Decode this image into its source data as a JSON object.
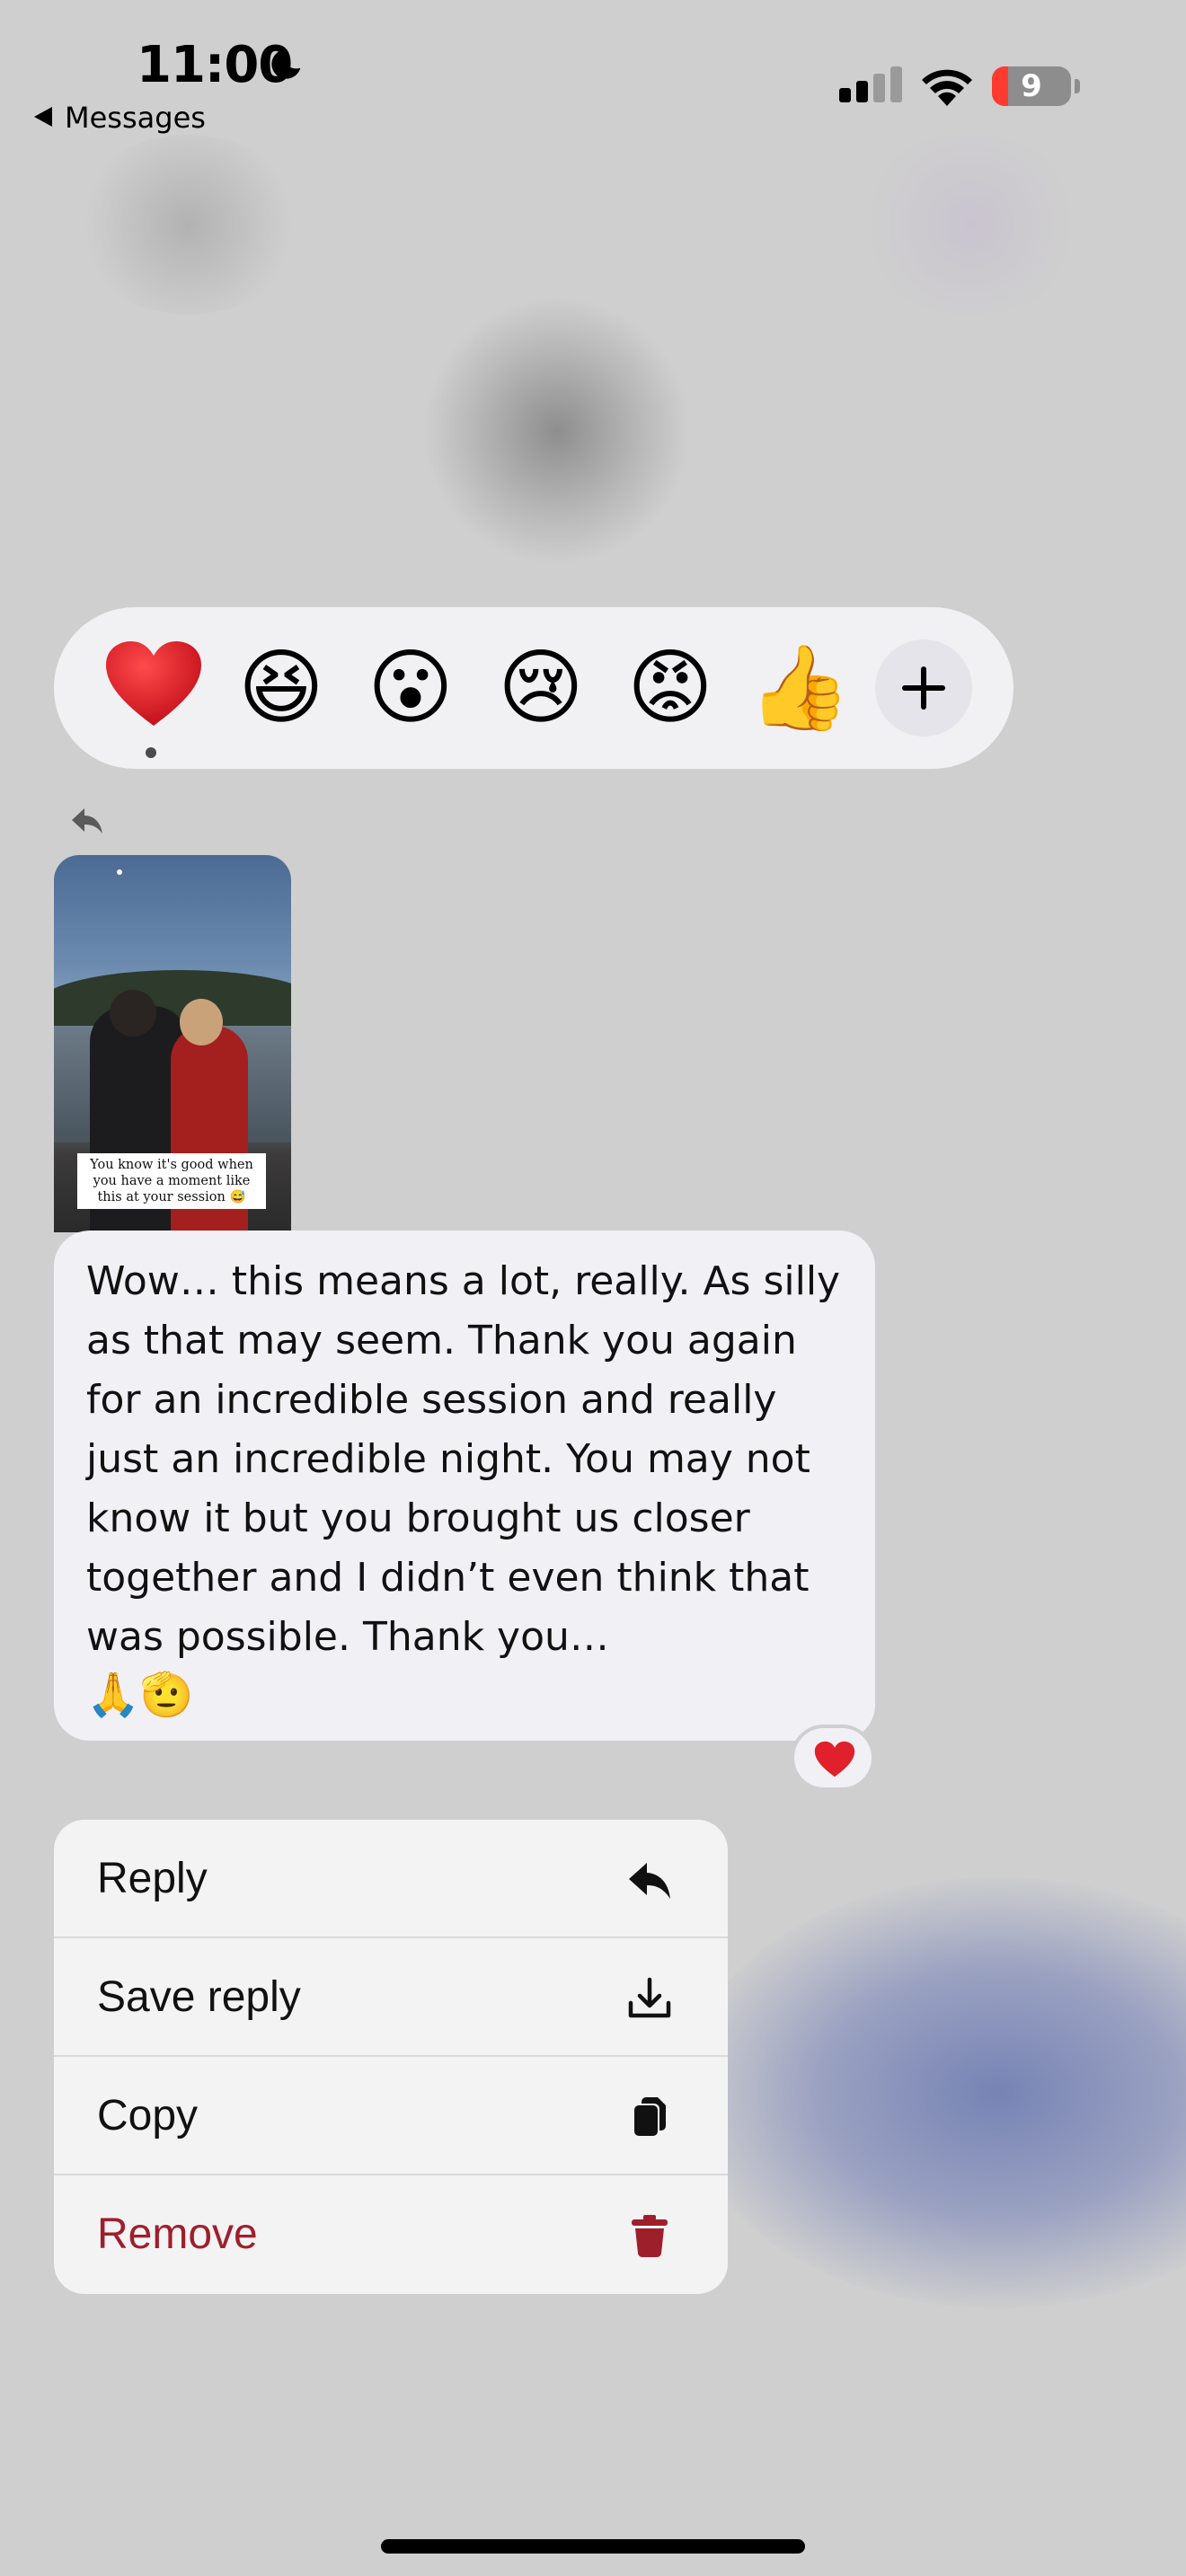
{
  "status_bar": {
    "time": "11:00",
    "back_app": "Messages",
    "battery_level": "9",
    "signal_bars": 2
  },
  "reactions": {
    "items": [
      {
        "name": "red-heart",
        "emoji": "❤️",
        "selected": true
      },
      {
        "name": "laughing",
        "emoji": "😆"
      },
      {
        "name": "surprised",
        "emoji": "😮"
      },
      {
        "name": "crying",
        "emoji": "😢"
      },
      {
        "name": "angry",
        "emoji": "😡"
      },
      {
        "name": "thumbs-up",
        "emoji": "👍"
      }
    ],
    "more_icon": "plus-icon"
  },
  "story": {
    "caption": "You know it's good when you have a moment like this at your session 😅"
  },
  "message": {
    "text": "Wow… this means a lot, really. As silly as that may seem. Thank you again for an incredible session and really just an incredible night. You may not know it but you brought us closer together and I didn’t even think that was possible. Thank you…",
    "emojis": "🙏🫡",
    "reaction": "❤️"
  },
  "menu": {
    "items": [
      {
        "label": "Reply",
        "icon": "reply-icon"
      },
      {
        "label": "Save reply",
        "icon": "download-icon"
      },
      {
        "label": "Copy",
        "icon": "copy-icon"
      },
      {
        "label": "Remove",
        "icon": "trash-icon",
        "color": "#9e1f2c"
      }
    ]
  }
}
